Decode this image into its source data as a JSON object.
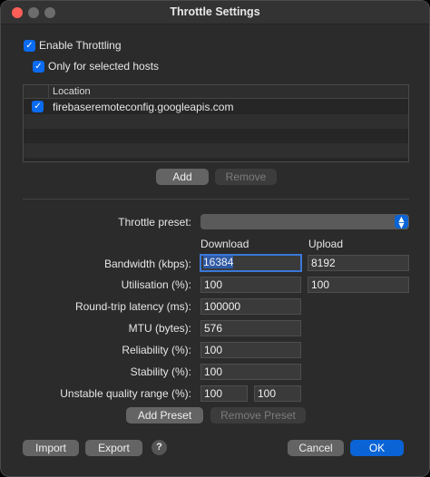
{
  "window": {
    "title": "Throttle Settings"
  },
  "enable_throttling": {
    "label": "Enable Throttling",
    "checked": true
  },
  "only_selected_hosts": {
    "label": "Only for selected hosts",
    "checked": true
  },
  "hosts_table": {
    "column_header": "Location",
    "rows": [
      {
        "checked": true,
        "location": "firebaseremoteconfig.googleapis.com"
      }
    ]
  },
  "host_buttons": {
    "add": "Add",
    "remove": "Remove"
  },
  "throttle_preset": {
    "label": "Throttle preset:",
    "value": ""
  },
  "columns": {
    "download": "Download",
    "upload": "Upload"
  },
  "settings": {
    "bandwidth": {
      "label": "Bandwidth (kbps):",
      "download": "16384",
      "upload": "8192"
    },
    "utilisation": {
      "label": "Utilisation (%):",
      "download": "100",
      "upload": "100"
    },
    "latency": {
      "label": "Round-trip latency (ms):",
      "value": "100000"
    },
    "mtu": {
      "label": "MTU (bytes):",
      "value": "576"
    },
    "reliability": {
      "label": "Reliability (%):",
      "value": "100"
    },
    "stability": {
      "label": "Stability (%):",
      "value": "100"
    },
    "unstable_quality": {
      "label": "Unstable quality range (%):",
      "min": "100",
      "max": "100"
    }
  },
  "preset_buttons": {
    "add": "Add Preset",
    "remove": "Remove Preset"
  },
  "footer": {
    "import": "Import",
    "export": "Export",
    "help": "?",
    "cancel": "Cancel",
    "ok": "OK"
  },
  "colors": {
    "accent": "#0a64d6",
    "close": "#ff5f57"
  }
}
